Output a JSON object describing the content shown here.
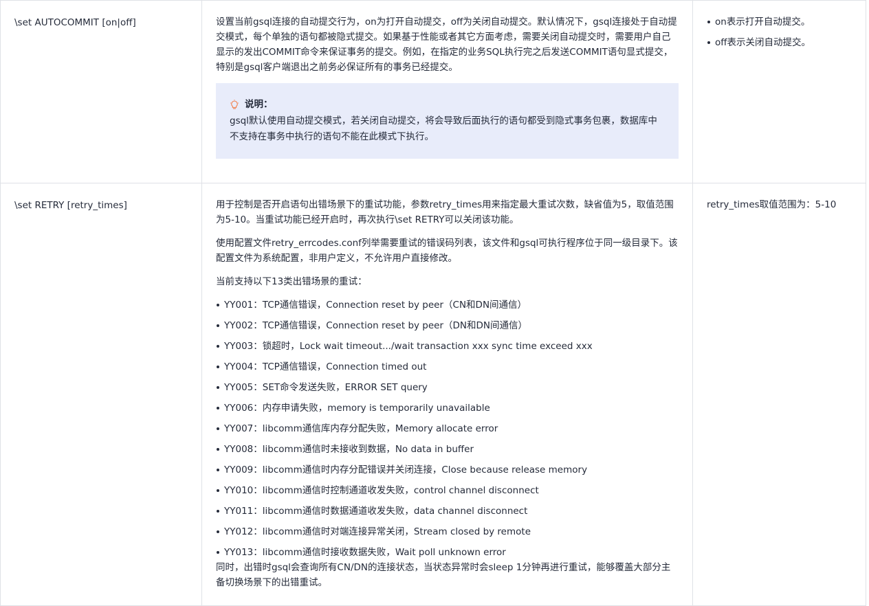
{
  "rows": [
    {
      "param": "\\set AUTOCOMMIT [on|off]",
      "desc_paragraphs": [
        "设置当前gsql连接的自动提交行为，on为打开自动提交，off为关闭自动提交。默认情况下，gsql连接处于自动提交模式，每个单独的语句都被隐式提交。如果基于性能或者其它方面考虑，需要关闭自动提交时，需要用户自己显示的发出COMMIT命令来保证事务的提交。例如，在指定的业务SQL执行完之后发送COMMIT语句显式提交，特别是gsql客户端退出之前务必保证所有的事务已经提交。"
      ],
      "note": {
        "title": "说明：",
        "icon": "lightbulb-icon",
        "text": "gsql默认使用自动提交模式，若关闭自动提交，将会导致后面执行的语句都受到隐式事务包裹，数据库中不支持在事务中执行的语句不能在此模式下执行。"
      },
      "values": [
        "on表示打开自动提交。",
        "off表示关闭自动提交。"
      ]
    },
    {
      "param": "\\set RETRY [retry_times]",
      "desc_paragraphs": [
        "用于控制是否开启语句出错场景下的重试功能，参数retry_times用来指定最大重试次数，缺省值为5，取值范围为5-10。当重试功能已经开启时，再次执行\\set RETRY可以关闭该功能。",
        "使用配置文件retry_errcodes.conf列举需要重试的错误码列表，该文件和gsql可执行程序位于同一级目录下。该配置文件为系统配置，非用户定义，不允许用户直接修改。",
        "当前支持以下13类出错场景的重试："
      ],
      "errors": [
        "YY001：TCP通信错误，Connection reset by peer（CN和DN间通信）",
        "YY002：TCP通信错误，Connection reset by peer（DN和DN间通信）",
        "YY003：锁超时，Lock wait timeout.../wait transaction xxx sync time exceed xxx",
        "YY004：TCP通信错误，Connection timed out",
        "YY005：SET命令发送失败，ERROR SET query",
        "YY006：内存申请失败，memory is temporarily unavailable",
        "YY007：libcomm通信库内存分配失败，Memory allocate error",
        "YY008：libcomm通信时未接收到数据，No data in buffer",
        "YY009：libcomm通信时内存分配错误并关闭连接，Close because release memory",
        "YY010：libcomm通信时控制通道收发失败，control channel disconnect",
        "YY011：libcomm通信时数据通道收发失败，data channel disconnect",
        "YY012：libcomm通信时对端连接异常关闭，Stream closed by remote",
        "YY013：libcomm通信时接收数据失败，Wait poll unknown error"
      ],
      "tail": "同时，出错时gsql会查询所有CN/DN的连接状态，当状态异常时会sleep 1分钟再进行重试，能够覆盖大部分主备切换场景下的出错重试。",
      "value_text": "retry_times取值范围为：5-10"
    }
  ]
}
